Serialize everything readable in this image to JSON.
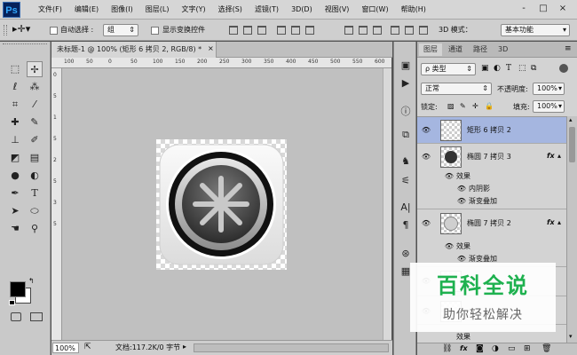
{
  "app": {
    "logo": "Ps"
  },
  "menubar": {
    "items": [
      "文件(F)",
      "编辑(E)",
      "图像(I)",
      "图层(L)",
      "文字(Y)",
      "选择(S)",
      "滤镜(T)",
      "3D(D)",
      "视图(V)",
      "窗口(W)",
      "帮助(H)"
    ],
    "window_controls": [
      "-",
      "□",
      "×"
    ]
  },
  "options_bar": {
    "auto_select_label": "自动选择 :",
    "auto_select_value": "组",
    "show_transform_label": "显示变换控件",
    "mode_3d": "3D 模式：",
    "workspace": "基本功能"
  },
  "document": {
    "tab_title": "未标题-1 @ 100% (矩形 6 拷贝 2, RGB/8) *",
    "ruler_h_labels": [
      "100",
      "50",
      "0",
      "50",
      "100",
      "150",
      "200",
      "250",
      "300",
      "350",
      "400",
      "450",
      "500",
      "550",
      "600"
    ],
    "ruler_v_labels": [
      "0",
      "5",
      "1",
      "5",
      "2",
      "5",
      "3",
      "5"
    ],
    "zoom": "100%",
    "doc_info": "文档:117.2K/0 字节"
  },
  "layers_panel": {
    "tabs": [
      "图层",
      "通道",
      "路径",
      "3D"
    ],
    "kind_filter": "ρ 类型",
    "blend_mode": "正常",
    "opacity_label": "不透明度:",
    "opacity_value": "100%",
    "lock_label": "锁定:",
    "fill_label": "填充:",
    "fill_value": "100%",
    "layers": [
      {
        "name": "矩形 6 拷贝 2",
        "selected": true
      },
      {
        "name": "椭圆 7 拷贝 3",
        "fx": "fx"
      },
      {
        "name": "椭圆 7 拷贝 2",
        "fx": "fx"
      }
    ],
    "effects_label": "效果",
    "effect_inner_shadow": "内阴影",
    "effect_gradient_overlay": "渐变叠加",
    "bottom_icons": [
      "link-icon",
      "fx-icon",
      "mask-icon",
      "adjustment-icon",
      "group-icon",
      "new-layer-icon",
      "trash-icon"
    ],
    "fx_text": "fx"
  },
  "watermark": {
    "title": "百科全说",
    "subtitle": "助你轻松解决"
  },
  "colors": {
    "selection": "#a5b6e0",
    "ps_blue": "#06225b",
    "watermark_green": "#1eb14f"
  }
}
